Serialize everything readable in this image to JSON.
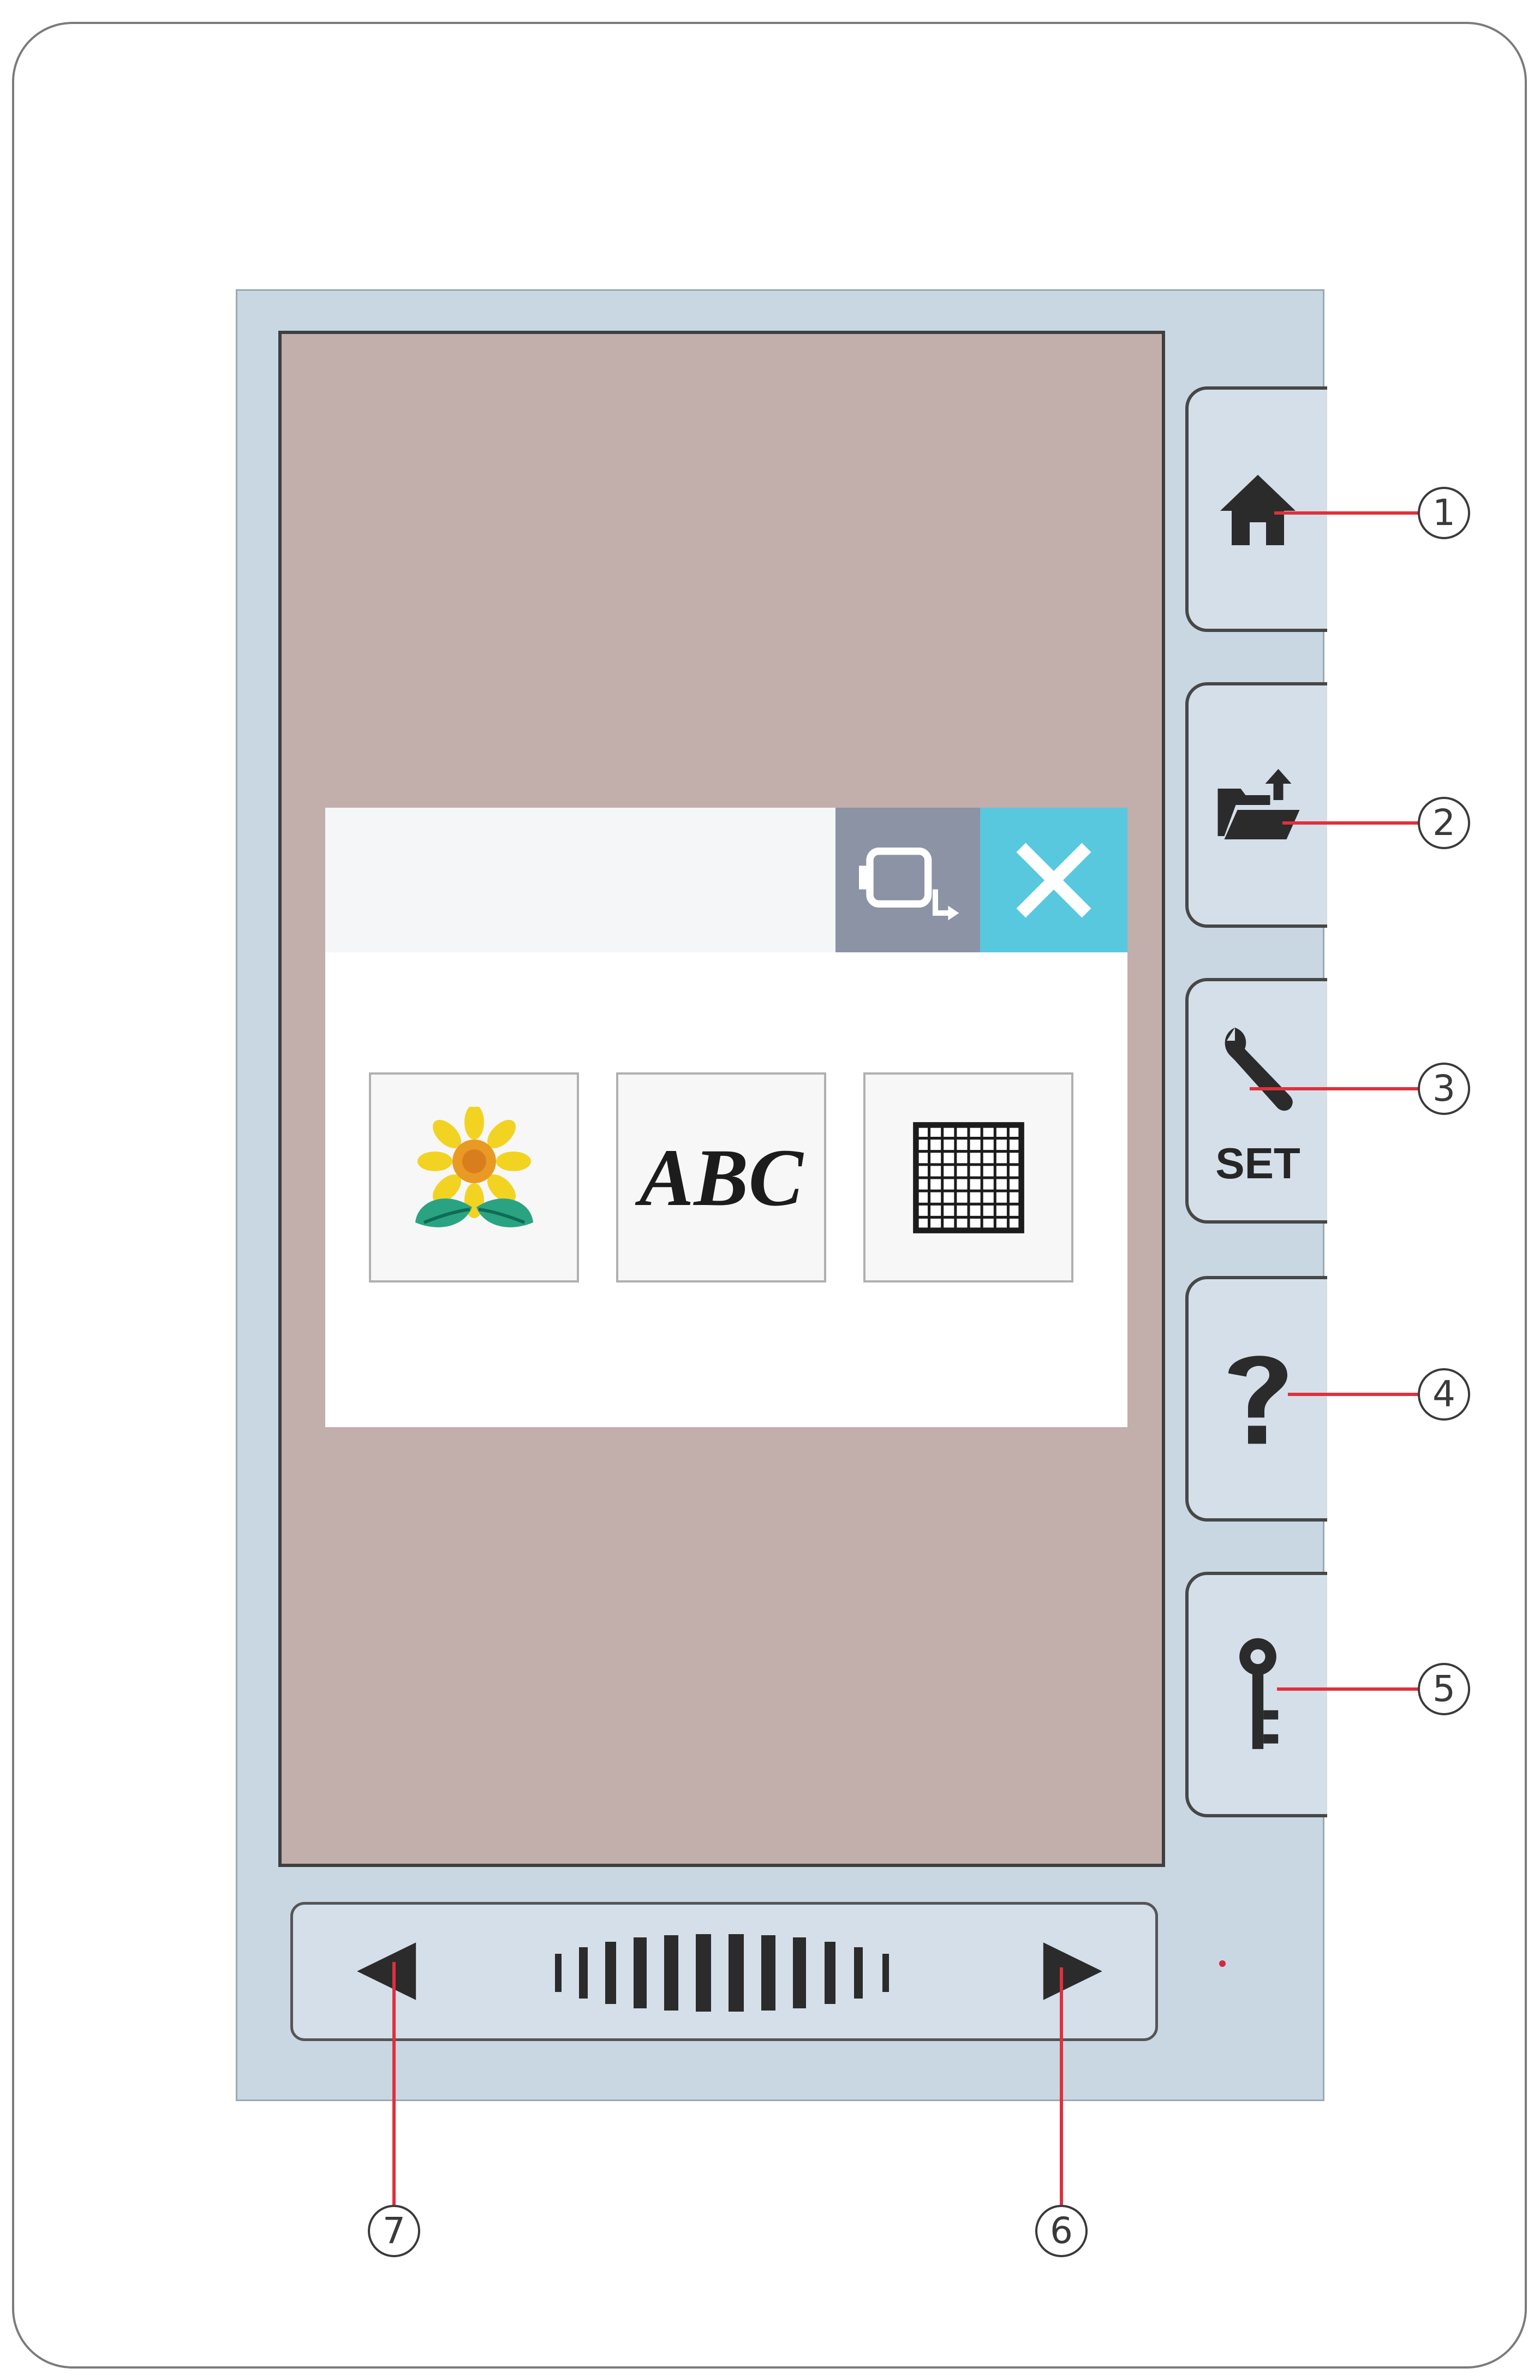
{
  "side_buttons": [
    {
      "number": "1",
      "icon": "home-icon"
    },
    {
      "number": "2",
      "icon": "folder-open-icon"
    },
    {
      "number": "3",
      "icon": "wrench-icon",
      "label": "SET"
    },
    {
      "number": "4",
      "icon": "question-icon"
    },
    {
      "number": "5",
      "icon": "key-icon"
    }
  ],
  "dialog": {
    "hoop_icon": "hoop-select-icon",
    "close_icon": "close-icon",
    "categories": [
      {
        "icon": "sunflower-icon"
      },
      {
        "label": "ABC"
      },
      {
        "icon": "grid-icon"
      }
    ]
  },
  "nav": {
    "prev_number": "7",
    "next_number": "6"
  },
  "colors": {
    "screen": "#c2aeab",
    "close_button": "#58c8df",
    "hoop_button": "#8b93a5",
    "callout_line": "#e0303c",
    "device": "#c9d7e3"
  }
}
